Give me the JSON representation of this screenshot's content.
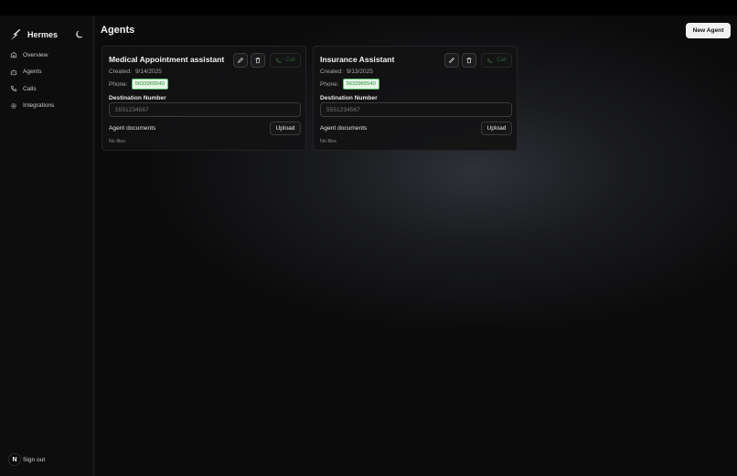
{
  "app": {
    "name": "Hermes"
  },
  "sidebar": {
    "items": [
      {
        "label": "Overview",
        "icon": "home-icon"
      },
      {
        "label": "Agents",
        "icon": "bot-icon"
      },
      {
        "label": "Calls",
        "icon": "phone-icon"
      },
      {
        "label": "Integrations",
        "icon": "gear-icon"
      }
    ],
    "signout_label": "Sign out",
    "avatar_initial": "N"
  },
  "page": {
    "title": "Agents",
    "new_agent_label": "New Agent"
  },
  "agents": [
    {
      "name": "Medical Appointment assistant",
      "created_label": "Created:",
      "created": "9/14/2025",
      "phone_label": "Phone:",
      "phone": "5633965540",
      "call_label": "Call",
      "destination_label": "Destination Number",
      "destination_placeholder": "5551234567",
      "documents_label": "Agent documents",
      "upload_label": "Upload",
      "files_text": "No files"
    },
    {
      "name": "Insurance Assistant",
      "created_label": "Created:",
      "created": "9/13/2025",
      "phone_label": "Phone:",
      "phone": "5633965540",
      "call_label": "Call",
      "destination_label": "Destination Number",
      "destination_placeholder": "5551234567",
      "documents_label": "Agent documents",
      "upload_label": "Upload",
      "files_text": "No files"
    }
  ],
  "colors": {
    "phone_badge_bg": "#e3f7e4",
    "phone_badge_text": "#2f8a3e",
    "call_disabled": "#2e5a34"
  }
}
